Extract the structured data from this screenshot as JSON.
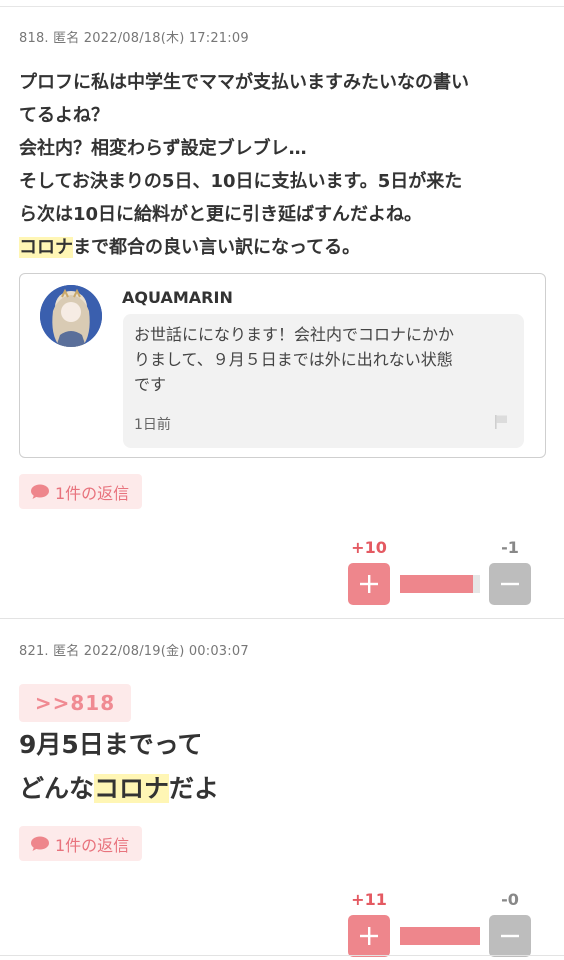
{
  "posts": [
    {
      "meta": "818. 匿名 2022/08/18(木) 17:21:09",
      "lines": [
        "プロフに私は中学生でママが支払いますみたいなの書い",
        "てるよね？",
        "会社内？相変わらず設定ブレブレ…",
        "そしてお決まりの5日、10日に支払います。5日が来た",
        "ら次は10日に給料がと更に引き延ばすんだよね。"
      ],
      "line6_hl": "コロナ",
      "line6_rest": "まで都合の良い言い訳になってる。",
      "quote": {
        "name": "AQUAMARIN",
        "text_lines": [
          "お世話にになります！会社内でコロナにかか",
          "りまして、９月５日までは外に出れない状態",
          "です"
        ],
        "time": "1日前"
      },
      "reply_label": "1件の返信",
      "votes": {
        "plus": "+10",
        "minus": "-1",
        "ratio": 0.91
      }
    },
    {
      "meta": "821. 匿名 2022/08/19(金) 00:03:07",
      "anchor": ">>818",
      "line1": "9月5日までって",
      "line2_pre": "どんな",
      "line2_hl": "コロナ",
      "line2_post": "だよ",
      "reply_label": "1件の返信",
      "votes": {
        "plus": "+11",
        "minus": "-0",
        "ratio": 1.0
      }
    }
  ],
  "colors": {
    "accent": "#ee868c",
    "accent_text": "#e45a62",
    "highlight": "#fff6b5",
    "reply_bg": "#fdeaea"
  }
}
